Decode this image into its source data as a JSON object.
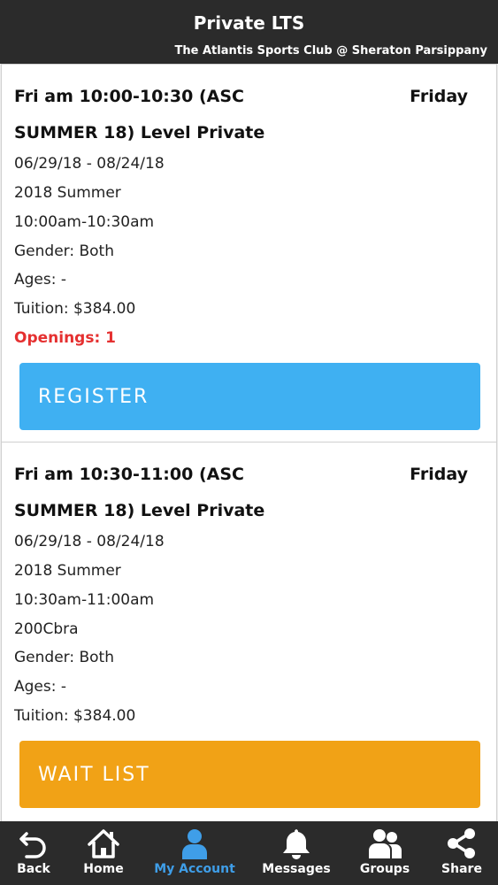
{
  "header": {
    "title": "Private LTS",
    "subtitle": "The Atlantis Sports Club @ Sheraton Parsippany"
  },
  "classes": [
    {
      "title_line1": "Fri am 10:00-10:30 (ASC",
      "title_line2": "SUMMER 18) Level Private",
      "day": "Friday",
      "dates": "06/29/18 - 08/24/18",
      "season": "2018 Summer",
      "time": "10:00am-10:30am",
      "gender": "Gender: Both",
      "ages": "Ages: -",
      "tuition": "Tuition: $384.00",
      "openings": "Openings: 1",
      "button_label": "REGISTER"
    },
    {
      "title_line1": "Fri am 10:30-11:00 (ASC",
      "title_line2": "SUMMER 18) Level Private",
      "day": "Friday",
      "dates": "06/29/18 - 08/24/18",
      "season": "2018 Summer",
      "time": "10:30am-11:00am",
      "location": "200Cbra",
      "gender": "Gender: Both",
      "ages": "Ages: -",
      "tuition": "Tuition: $384.00",
      "button_label": "WAIT LIST"
    }
  ],
  "tabbar": {
    "back": "Back",
    "home": "Home",
    "account": "My Account",
    "messages": "Messages",
    "groups": "Groups",
    "share": "Share"
  },
  "colors": {
    "register": "#3fb0f2",
    "waitlist": "#f1a216",
    "openings": "#e53030",
    "active_tab": "#3f9ee8"
  }
}
